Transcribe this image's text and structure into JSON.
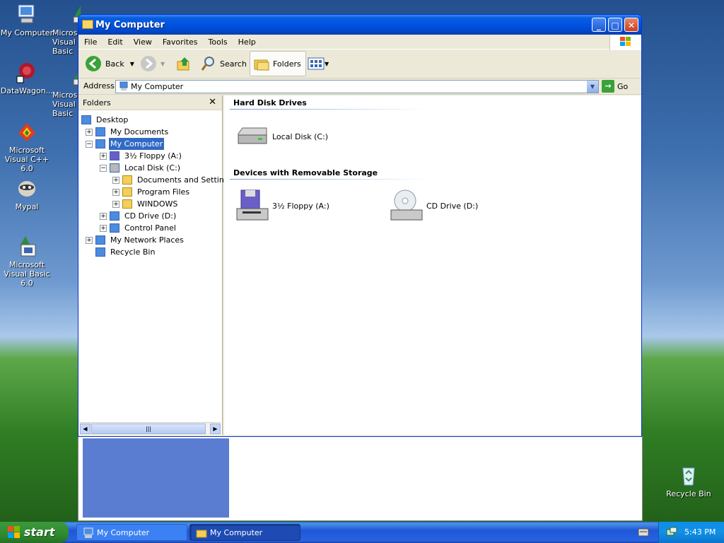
{
  "desktop": {
    "icons": [
      {
        "label": "My Computer",
        "icon": "my-computer-icon"
      },
      {
        "label": "Microsoft Visual Basic",
        "icon": "vb-shortcut-icon"
      },
      {
        "label": "DataWagon...",
        "icon": "datawagon-icon"
      },
      {
        "label": "Microsoft Visual Basic",
        "icon": "vb-shortcut-icon"
      },
      {
        "label": "Microsoft Visual C++ 6.0",
        "icon": "vc-icon"
      },
      {
        "label": "Mypal",
        "icon": "mypal-icon"
      },
      {
        "label": "Microsoft Visual Basic 6.0",
        "icon": "vb6-icon"
      },
      {
        "label": "Recycle Bin",
        "icon": "recycle-bin-icon"
      }
    ]
  },
  "window": {
    "title": "My Computer",
    "menu": [
      "File",
      "Edit",
      "View",
      "Favorites",
      "Tools",
      "Help"
    ],
    "toolbar": {
      "back": "Back",
      "search": "Search",
      "folders": "Folders"
    },
    "address": {
      "label": "Address",
      "value": "My Computer",
      "go": "Go"
    },
    "folders_pane": {
      "title": "Folders",
      "tree": [
        {
          "label": "Desktop",
          "level": 0,
          "expander": "",
          "icon": "desktop-icon"
        },
        {
          "label": "My Documents",
          "level": 1,
          "expander": "+",
          "icon": "my-documents-icon"
        },
        {
          "label": "My Computer",
          "level": 1,
          "expander": "−",
          "icon": "my-computer-icon",
          "selected": true
        },
        {
          "label": "3½ Floppy (A:)",
          "level": 2,
          "expander": "+",
          "icon": "floppy-icon"
        },
        {
          "label": "Local Disk (C:)",
          "level": 2,
          "expander": "−",
          "icon": "hard-disk-icon"
        },
        {
          "label": "Documents and Settings",
          "level": 3,
          "expander": "+",
          "icon": "folder-icon"
        },
        {
          "label": "Program Files",
          "level": 3,
          "expander": "+",
          "icon": "folder-icon"
        },
        {
          "label": "WINDOWS",
          "level": 3,
          "expander": "+",
          "icon": "folder-icon"
        },
        {
          "label": "CD Drive (D:)",
          "level": 2,
          "expander": "+",
          "icon": "cd-drive-icon"
        },
        {
          "label": "Control Panel",
          "level": 2,
          "expander": "+",
          "icon": "control-panel-icon"
        },
        {
          "label": "My Network Places",
          "level": 1,
          "expander": "+",
          "icon": "network-places-icon"
        },
        {
          "label": "Recycle Bin",
          "level": 1,
          "expander": "",
          "icon": "recycle-bin-icon"
        }
      ]
    },
    "content": {
      "sections": [
        {
          "title": "Hard Disk Drives",
          "items": [
            {
              "label": "Local Disk (C:)",
              "icon": "hard-disk-icon"
            }
          ]
        },
        {
          "title": "Devices with Removable Storage",
          "items": [
            {
              "label": "3½ Floppy (A:)",
              "icon": "floppy-icon"
            },
            {
              "label": "CD Drive (D:)",
              "icon": "cd-drive-icon"
            }
          ]
        }
      ]
    }
  },
  "taskbar": {
    "start": "start",
    "buttons": [
      {
        "label": "My Computer",
        "active": false
      },
      {
        "label": "My Computer",
        "active": true
      }
    ],
    "clock": "5:43 PM"
  },
  "colors": {
    "title_bar": "#0053e1",
    "selection": "#316ac5",
    "taskbar": "#2157d7",
    "start_button": "#2f8a2f"
  }
}
